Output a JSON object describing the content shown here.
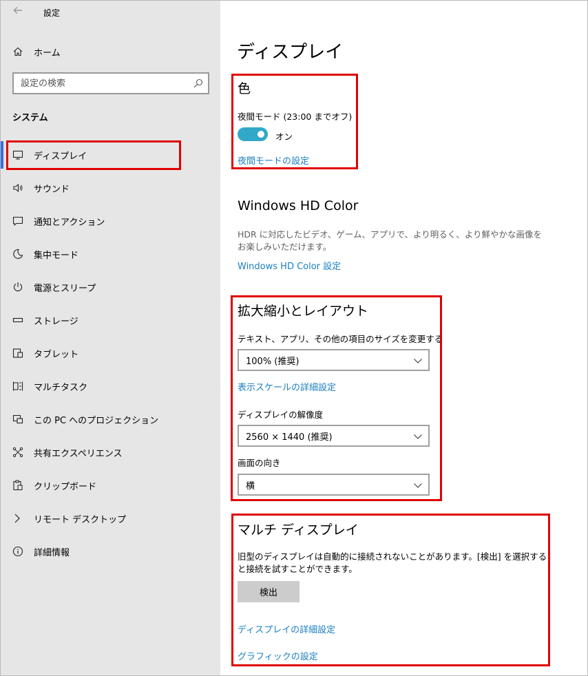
{
  "window": {
    "title": "設定",
    "back_icon": "back-arrow-icon"
  },
  "sidebar": {
    "home_label": "ホーム",
    "search_placeholder": "設定の検索",
    "section_title": "システム",
    "items": [
      {
        "label": "ディスプレイ",
        "icon": "monitor-icon",
        "active": true
      },
      {
        "label": "サウンド",
        "icon": "speaker-icon"
      },
      {
        "label": "通知とアクション",
        "icon": "notification-icon"
      },
      {
        "label": "集中モード",
        "icon": "moon-icon"
      },
      {
        "label": "電源とスリープ",
        "icon": "power-icon"
      },
      {
        "label": "ストレージ",
        "icon": "storage-icon"
      },
      {
        "label": "タブレット",
        "icon": "tablet-icon"
      },
      {
        "label": "マルチタスク",
        "icon": "multitask-icon"
      },
      {
        "label": "この PC へのプロジェクション",
        "icon": "projection-icon"
      },
      {
        "label": "共有エクスペリエンス",
        "icon": "share-icon"
      },
      {
        "label": "クリップボード",
        "icon": "clipboard-icon"
      },
      {
        "label": "リモート デスクトップ",
        "icon": "remote-icon"
      },
      {
        "label": "詳細情報",
        "icon": "info-icon"
      }
    ]
  },
  "main": {
    "title": "ディスプレイ",
    "color": {
      "heading": "色",
      "night_mode_label": "夜間モード (23:00 までオフ)",
      "toggle_state": "オン",
      "night_mode_link": "夜間モードの設定"
    },
    "hdr": {
      "heading": "Windows HD Color",
      "description": "HDR に対応したビデオ、ゲーム、アプリで、より明るく、より鮮やかな画像をお楽しみいただけます。",
      "link": "Windows HD Color 設定"
    },
    "scale": {
      "heading": "拡大縮小とレイアウト",
      "size_label": "テキスト、アプリ、その他の項目のサイズを変更する",
      "size_value": "100% (推奨)",
      "advanced_link": "表示スケールの詳細設定",
      "resolution_label": "ディスプレイの解像度",
      "resolution_value": "2560 × 1440 (推奨)",
      "orientation_label": "画面の向き",
      "orientation_value": "横"
    },
    "multi": {
      "heading": "マルチ ディスプレイ",
      "description": "旧型のディスプレイは自動的に接続されないことがあります。[検出] を選択すると接続を試すことができます。",
      "detect_button": "検出",
      "advanced_link": "ディスプレイの詳細設定",
      "graphics_link": "グラフィックの設定"
    }
  },
  "colors": {
    "accent": "#1a7fbf",
    "toggle_on": "#32a8c9",
    "highlight": "#e00000",
    "sidebar_bg": "#e6e6e6"
  }
}
